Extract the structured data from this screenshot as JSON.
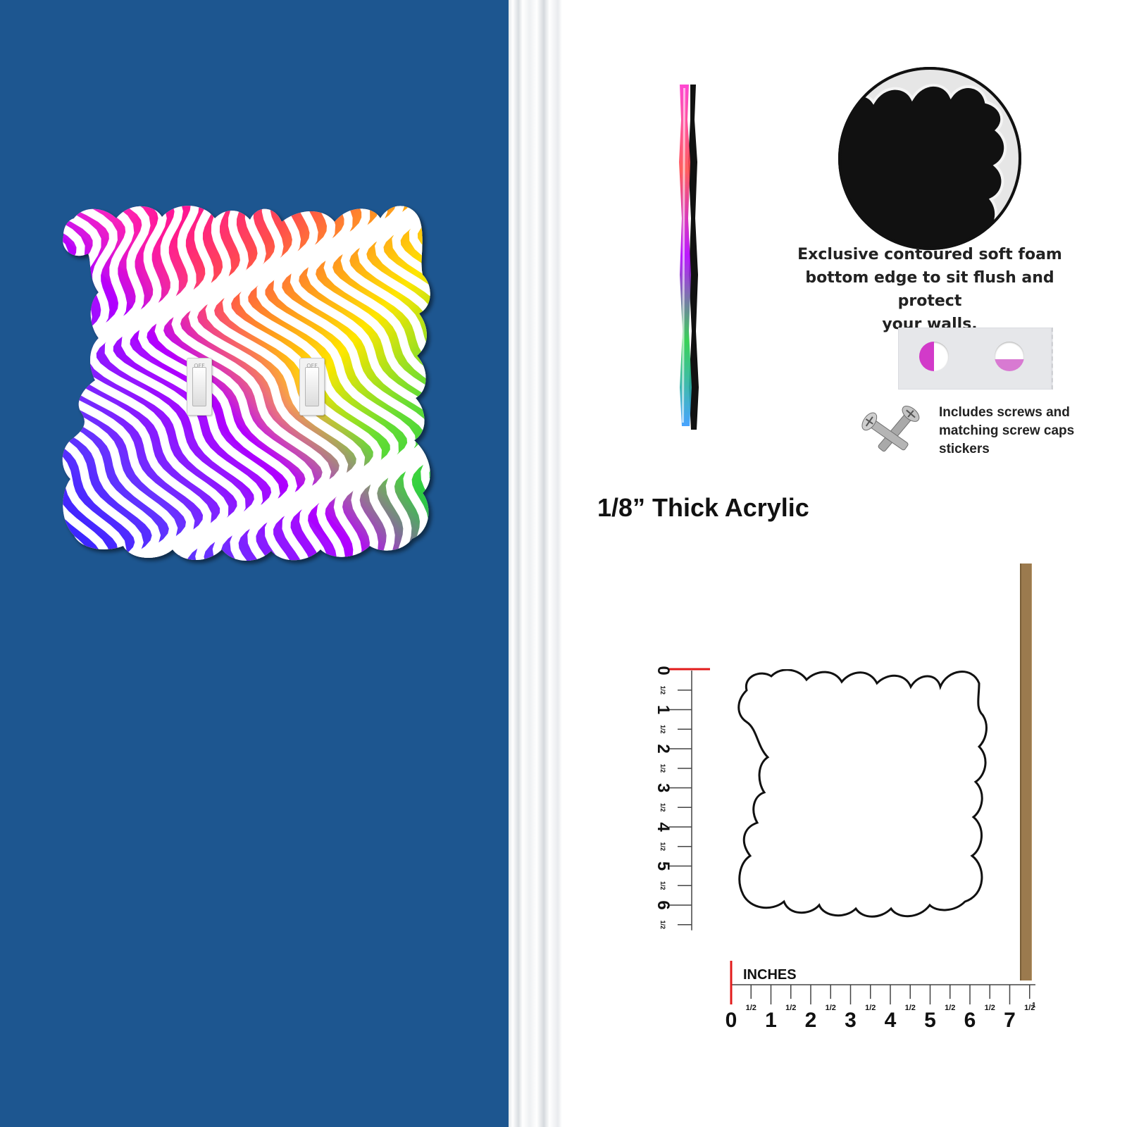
{
  "left_panel": {
    "wall_color": "#1d5690",
    "switches": [
      {
        "label": "OFF"
      },
      {
        "label": "OFF"
      }
    ]
  },
  "features": {
    "foam_caption_lines": [
      "Exclusive contoured soft foam",
      "bottom edge to sit flush and protect",
      "your walls."
    ],
    "screws_caption_lines": [
      "Includes screws and",
      "matching screw caps",
      "stickers"
    ],
    "thickness_label": "1/8” Thick Acrylic"
  },
  "dimensions": {
    "units_label": "INCHES",
    "vertical_major": [
      "0",
      "1",
      "2",
      "3",
      "4",
      "5",
      "6"
    ],
    "horizontal_major": [
      "0",
      "1",
      "2",
      "3",
      "4",
      "5",
      "6",
      "7"
    ],
    "half_label": "1/2",
    "trailing_label": "1"
  },
  "colors": {
    "pattern": [
      "#ff33cc",
      "#ff1493",
      "#ff4d4d",
      "#ffa31a",
      "#ffe600",
      "#66dd33",
      "#22cc44",
      "#3399ff",
      "#6633ff",
      "#1a1aff",
      "#b300ff"
    ],
    "ruler_zero_mark": "#e21b1b",
    "brown_strip": "#9b7a4e"
  }
}
